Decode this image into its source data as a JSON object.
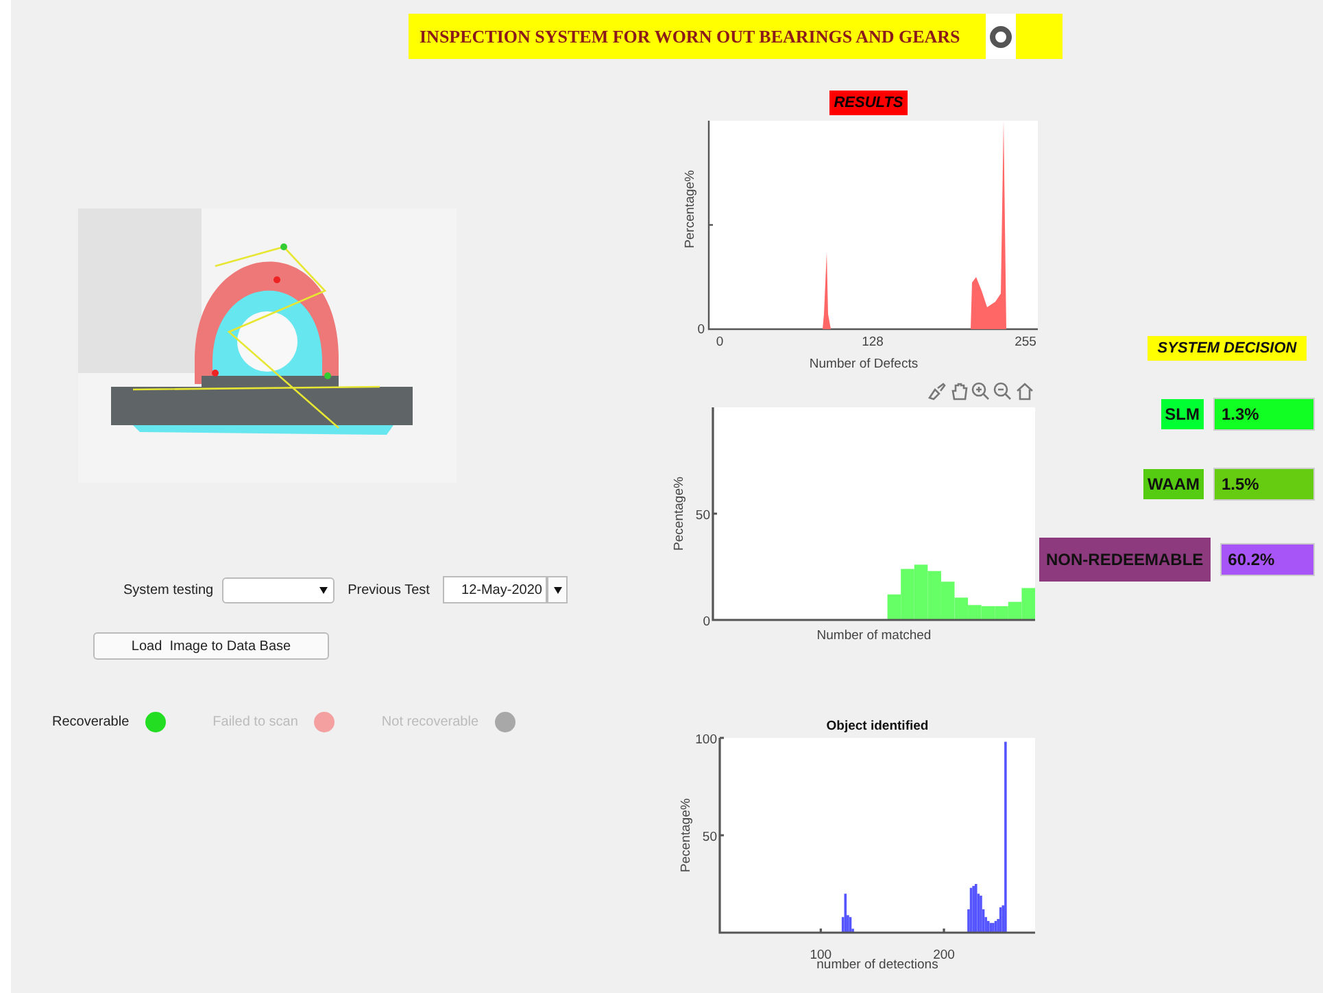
{
  "title": "INSPECTION SYSTEM FOR WORN OUT BEARINGS AND GEARS",
  "results": {
    "heading": "RESULTS",
    "defects_plot": {
      "y_label": "Percentage%",
      "y_tick_labels": [
        "0"
      ],
      "x_tick_labels": [
        "0",
        "128",
        "255"
      ],
      "x_label": "Number of Defects"
    },
    "matched_plot": {
      "chart_data": {
        "type": "bar",
        "xlabel": "Number of matched",
        "ylabel": "Pecentage%",
        "ylim": [
          0,
          100
        ],
        "yticks": [
          0,
          50
        ],
        "color": "#66ff66",
        "values": [
          0,
          0,
          0,
          0,
          0,
          0,
          0,
          0,
          0,
          0,
          0,
          0,
          0,
          12,
          24,
          26,
          23,
          18,
          10.5,
          7,
          6.5,
          6.5,
          8.5,
          15
        ]
      }
    },
    "detections_plot": {
      "chart_data": {
        "type": "bar",
        "title": "Object identified",
        "xlabel": "number of detections",
        "ylabel": "Pecentage%",
        "xlim": [
          18,
          274
        ],
        "ylim": [
          0,
          100
        ],
        "xticks": [
          100,
          200
        ],
        "yticks": [
          50,
          100
        ],
        "color": "#5555ff",
        "x": [
          118,
          120,
          122,
          124,
          126,
          220,
          222,
          224,
          226,
          228,
          230,
          232,
          234,
          236,
          238,
          240,
          242,
          244,
          246,
          248,
          250,
          252
        ],
        "values": [
          8,
          20,
          9,
          8,
          2,
          12,
          23,
          24,
          25,
          20,
          19,
          12,
          8,
          6,
          5,
          5,
          6,
          7,
          13,
          14,
          98,
          0
        ]
      }
    }
  },
  "controls": {
    "system_testing_label": "System testing",
    "previous_test_label": "Previous Test",
    "previous_test_value": "12-May-2020",
    "load_button": "Load  Image to Data Base"
  },
  "lamps": [
    {
      "label": "Recoverable",
      "color": "#22dd22",
      "active": true
    },
    {
      "label": "Failed to scan",
      "color": "#f4a0a0",
      "active": false
    },
    {
      "label": "Not recoverable",
      "color": "#a8a8a8",
      "active": false
    }
  ],
  "decision": {
    "heading": "SYSTEM DECISION",
    "items": [
      {
        "label": {
          "text": "SLM",
          "color": "#00ff33"
        },
        "value": {
          "text": "1.3%",
          "color": "#11ff22"
        }
      },
      {
        "label": {
          "text": "WAAM",
          "color": "#55cc11"
        },
        "value": {
          "text": "1.5%",
          "color": "#66cc11"
        }
      },
      {
        "label": {
          "text": "NON-REDEEMABLE",
          "color": "#8e3a7e"
        },
        "value": {
          "text": "60.2%",
          "color": "#a855f7"
        }
      }
    ]
  }
}
